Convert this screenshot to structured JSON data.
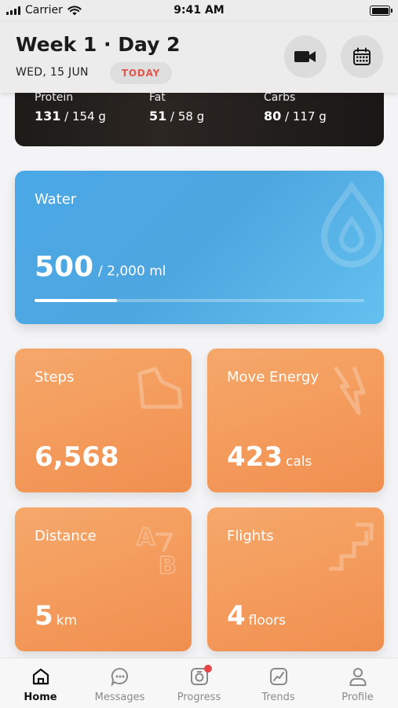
{
  "status_bar": {
    "carrier": "Carrier",
    "time": "9:41 AM"
  },
  "header": {
    "title": "Week 1 · Day 2",
    "date": "WED, 15 JUN",
    "today_badge": "TODAY",
    "video_icon": "video-camera-icon",
    "calendar_icon": "calendar-icon"
  },
  "macros": [
    {
      "label": "Protein",
      "value": "131",
      "goal": " / 154 g"
    },
    {
      "label": "Fat",
      "value": "51",
      "goal": " / 58 g"
    },
    {
      "label": "Carbs",
      "value": "80",
      "goal": " / 117 g"
    }
  ],
  "water": {
    "label": "Water",
    "value": "500",
    "goal": "/  2,000 ml",
    "progress": 0.25,
    "color": "#4ea6df"
  },
  "stats": [
    {
      "label": "Steps",
      "value": "6,568",
      "unit": ""
    },
    {
      "label": "Move Energy",
      "value": "423",
      "unit": "cals"
    },
    {
      "label": "Distance",
      "value": "5",
      "unit": "km"
    },
    {
      "label": "Flights",
      "value": "4",
      "unit": "floors"
    }
  ],
  "accent_orange": "#f3995a",
  "tabs": [
    {
      "label": "Home",
      "icon": "home-icon",
      "active": true
    },
    {
      "label": "Messages",
      "icon": "chat-bubble-icon",
      "active": false
    },
    {
      "label": "Progress",
      "icon": "camera-progress-icon",
      "active": false,
      "badge": true
    },
    {
      "label": "Trends",
      "icon": "trend-chart-icon",
      "active": false
    },
    {
      "label": "Profile",
      "icon": "person-icon",
      "active": false
    }
  ]
}
